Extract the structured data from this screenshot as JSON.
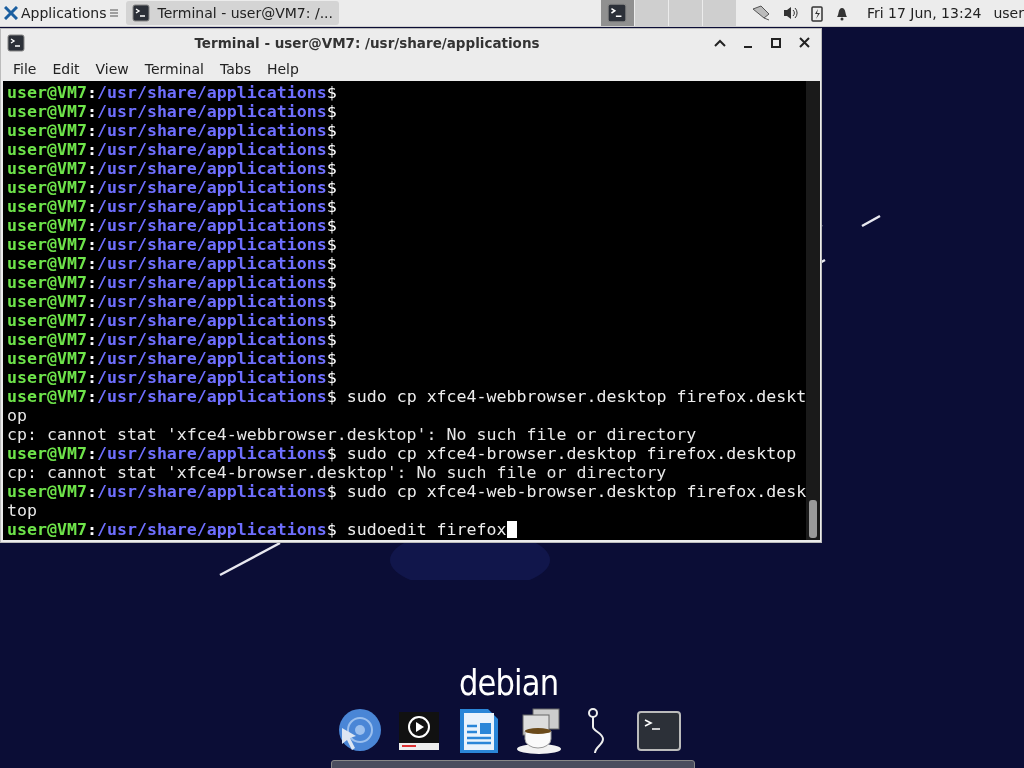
{
  "panel": {
    "menu_label": "Applications",
    "tasks": [
      {
        "label": "Terminal - user@VM7: /...",
        "selected": true
      }
    ],
    "workspaces": [
      {
        "selected": true
      },
      {
        "selected": false
      },
      {
        "selected": false
      },
      {
        "selected": false
      }
    ],
    "clock": "Fri 17 Jun, 13:24",
    "user": "user"
  },
  "window": {
    "title": "Terminal - user@VM7: /usr/share/applications",
    "menu": [
      "File",
      "Edit",
      "View",
      "Terminal",
      "Tabs",
      "Help"
    ],
    "lines": [
      {
        "kind": "prompt",
        "user": "user@VM7",
        "colon": ":",
        "path": "/usr/share/applications",
        "sign": "$"
      },
      {
        "kind": "prompt",
        "user": "user@VM7",
        "colon": ":",
        "path": "/usr/share/applications",
        "sign": "$"
      },
      {
        "kind": "prompt",
        "user": "user@VM7",
        "colon": ":",
        "path": "/usr/share/applications",
        "sign": "$"
      },
      {
        "kind": "prompt",
        "user": "user@VM7",
        "colon": ":",
        "path": "/usr/share/applications",
        "sign": "$"
      },
      {
        "kind": "prompt",
        "user": "user@VM7",
        "colon": ":",
        "path": "/usr/share/applications",
        "sign": "$"
      },
      {
        "kind": "prompt",
        "user": "user@VM7",
        "colon": ":",
        "path": "/usr/share/applications",
        "sign": "$"
      },
      {
        "kind": "prompt",
        "user": "user@VM7",
        "colon": ":",
        "path": "/usr/share/applications",
        "sign": "$"
      },
      {
        "kind": "prompt",
        "user": "user@VM7",
        "colon": ":",
        "path": "/usr/share/applications",
        "sign": "$"
      },
      {
        "kind": "prompt",
        "user": "user@VM7",
        "colon": ":",
        "path": "/usr/share/applications",
        "sign": "$"
      },
      {
        "kind": "prompt",
        "user": "user@VM7",
        "colon": ":",
        "path": "/usr/share/applications",
        "sign": "$"
      },
      {
        "kind": "prompt",
        "user": "user@VM7",
        "colon": ":",
        "path": "/usr/share/applications",
        "sign": "$"
      },
      {
        "kind": "prompt",
        "user": "user@VM7",
        "colon": ":",
        "path": "/usr/share/applications",
        "sign": "$"
      },
      {
        "kind": "prompt",
        "user": "user@VM7",
        "colon": ":",
        "path": "/usr/share/applications",
        "sign": "$"
      },
      {
        "kind": "prompt",
        "user": "user@VM7",
        "colon": ":",
        "path": "/usr/share/applications",
        "sign": "$"
      },
      {
        "kind": "prompt",
        "user": "user@VM7",
        "colon": ":",
        "path": "/usr/share/applications",
        "sign": "$"
      },
      {
        "kind": "prompt",
        "user": "user@VM7",
        "colon": ":",
        "path": "/usr/share/applications",
        "sign": "$"
      },
      {
        "kind": "prompt",
        "user": "user@VM7",
        "colon": ":",
        "path": "/usr/share/applications",
        "sign": "$",
        "command": " sudo cp xfce4-webbrowser.desktop firefox.deskt"
      },
      {
        "kind": "output",
        "text": "op"
      },
      {
        "kind": "output",
        "text": "cp: cannot stat 'xfce4-webbrowser.desktop': No such file or directory"
      },
      {
        "kind": "prompt",
        "user": "user@VM7",
        "colon": ":",
        "path": "/usr/share/applications",
        "sign": "$",
        "command": " sudo cp xfce4-browser.desktop firefox.desktop"
      },
      {
        "kind": "output",
        "text": "cp: cannot stat 'xfce4-browser.desktop': No such file or directory"
      },
      {
        "kind": "prompt",
        "user": "user@VM7",
        "colon": ":",
        "path": "/usr/share/applications",
        "sign": "$",
        "command": " sudo cp xfce4-web-browser.desktop firefox.desk"
      },
      {
        "kind": "output",
        "text": "top"
      },
      {
        "kind": "prompt",
        "user": "user@VM7",
        "colon": ":",
        "path": "/usr/share/applications",
        "sign": "$",
        "command": " sudoedit firefox",
        "cursor": true
      }
    ]
  },
  "logo": "debian",
  "dock": [
    {
      "kind": "browser"
    },
    {
      "kind": "media"
    },
    {
      "kind": "writer"
    },
    {
      "kind": "coffee"
    },
    {
      "kind": "hook"
    },
    {
      "kind": "terminal"
    }
  ]
}
